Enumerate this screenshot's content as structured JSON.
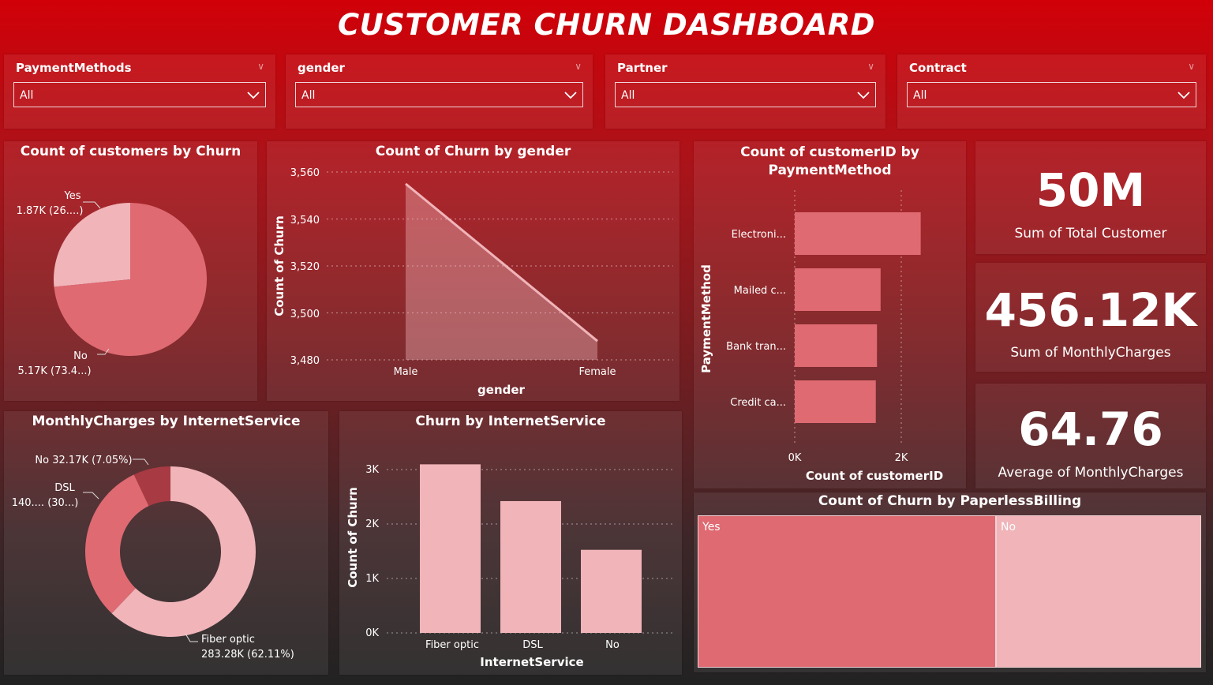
{
  "title": "CUSTOMER CHURN DASHBOARD",
  "colors": {
    "primary": "#df6a72",
    "light": "#f0b4b9",
    "dark": "#a83a43"
  },
  "slicers": [
    {
      "label": "PaymentMethods",
      "value": "All"
    },
    {
      "label": "gender",
      "value": "All"
    },
    {
      "label": "Partner",
      "value": "All"
    },
    {
      "label": "Contract",
      "value": "All"
    }
  ],
  "churn_pie": {
    "title": "Count of customers by Churn",
    "yes_name": "Yes",
    "yes_value": "1.87K (26....)",
    "no_name": "No",
    "no_value": "5.17K (73.4...)"
  },
  "gender_area": {
    "title": "Count of Churn by gender",
    "ylabel": "Count of Churn",
    "xlabel": "gender",
    "yticks": [
      "3,560",
      "3,540",
      "3,520",
      "3,500",
      "3,480"
    ],
    "xticks": [
      "Male",
      "Female"
    ]
  },
  "payment_bar": {
    "title": "Count of customerID by PaymentMethod",
    "ylabel": "PaymentMethod",
    "xlabel": "Count of customerID",
    "categories": [
      "Electroni...",
      "Mailed c...",
      "Bank tran...",
      "Credit ca..."
    ],
    "xticks": [
      "0K",
      "2K"
    ]
  },
  "kpis": [
    {
      "value": "50M",
      "label": "Sum of Total Customer"
    },
    {
      "value": "456.12K",
      "label": "Sum of MonthlyCharges"
    },
    {
      "value": "64.76",
      "label": "Average of MonthlyCharges"
    }
  ],
  "donut": {
    "title": "MonthlyCharges by InternetService",
    "no_label": "No 32.17K (7.05%)",
    "dsl_name": "DSL",
    "dsl_value": "140.... (30...)",
    "fiber_name": "Fiber optic",
    "fiber_value": "283.28K (62.11%)"
  },
  "internet_bar": {
    "title": "Churn by InternetService",
    "ylabel": "Count of Churn",
    "xlabel": "InternetService",
    "yticks": [
      "3K",
      "2K",
      "1K",
      "0K"
    ]
  },
  "treemap": {
    "title": "Count of Churn by PaperlessBilling",
    "labels": [
      "Yes",
      "No"
    ]
  },
  "chart_data": [
    {
      "type": "pie",
      "title": "Count of customers by Churn",
      "categories": [
        "Yes",
        "No"
      ],
      "values": [
        1870,
        5170
      ],
      "percent": [
        26.6,
        73.4
      ]
    },
    {
      "type": "area",
      "title": "Count of Churn by gender",
      "xlabel": "gender",
      "ylabel": "Count of Churn",
      "x": [
        "Male",
        "Female"
      ],
      "values": [
        3555,
        3488
      ],
      "ylim": [
        3480,
        3560
      ]
    },
    {
      "type": "bar",
      "orientation": "horizontal",
      "title": "Count of customerID by PaymentMethod",
      "xlabel": "Count of customerID",
      "ylabel": "PaymentMethod",
      "categories": [
        "Electroni...",
        "Mailed c...",
        "Bank tran...",
        "Credit ca..."
      ],
      "values": [
        2365,
        1612,
        1544,
        1522
      ],
      "xlim": [
        0,
        2000
      ]
    },
    {
      "type": "pie",
      "subtype": "donut",
      "title": "MonthlyCharges by InternetService",
      "categories": [
        "Fiber optic",
        "DSL",
        "No"
      ],
      "values": [
        283280,
        140670,
        32170
      ],
      "percent": [
        62.11,
        30.84,
        7.05
      ]
    },
    {
      "type": "bar",
      "title": "Churn by InternetService",
      "xlabel": "InternetService",
      "ylabel": "Count of Churn",
      "categories": [
        "Fiber optic",
        "DSL",
        "No"
      ],
      "values": [
        3096,
        2421,
        1526
      ],
      "ylim": [
        0,
        3000
      ]
    },
    {
      "type": "heatmap",
      "subtype": "treemap",
      "title": "Count of Churn by PaperlessBilling",
      "categories": [
        "Yes",
        "No"
      ],
      "values": [
        4171,
        2872
      ]
    }
  ]
}
